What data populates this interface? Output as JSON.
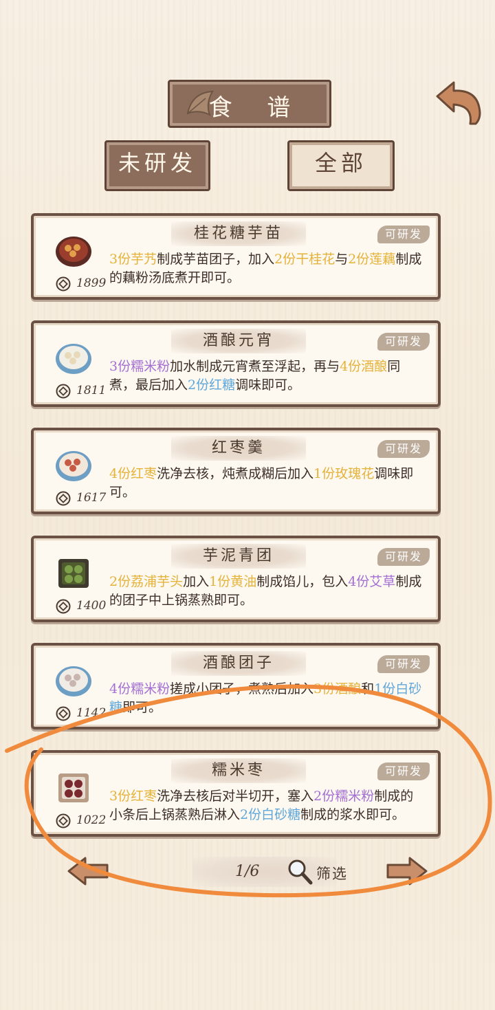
{
  "header": {
    "title": "食 谱"
  },
  "tabs": [
    {
      "label": "未研发",
      "active": true
    },
    {
      "label": "全部",
      "active": false
    }
  ],
  "recipes": [
    {
      "name": "桂花糖芋苗",
      "badge": "可研发",
      "price": "1899",
      "desc": [
        {
          "t": "3份芋艿",
          "c": "yellow"
        },
        {
          "t": "制成芋苗团子，加入"
        },
        {
          "t": "2份干桂花",
          "c": "yellow"
        },
        {
          "t": "与"
        },
        {
          "t": "2份莲藕",
          "c": "yellow"
        },
        {
          "t": "制成的藕粉汤底煮开即可。"
        }
      ]
    },
    {
      "name": "酒酿元宵",
      "badge": "可研发",
      "price": "1811",
      "desc": [
        {
          "t": "3份糯米粉",
          "c": "purple"
        },
        {
          "t": "加水制成元宵煮至浮起，再与"
        },
        {
          "t": "4份酒酿",
          "c": "yellow"
        },
        {
          "t": "同煮，最后加入"
        },
        {
          "t": "2份红糖",
          "c": "blue"
        },
        {
          "t": "调味即可。"
        }
      ]
    },
    {
      "name": "红枣羹",
      "badge": "可研发",
      "price": "1617",
      "desc": [
        {
          "t": "4份红枣",
          "c": "yellow"
        },
        {
          "t": "洗净去核，炖煮成糊后加入"
        },
        {
          "t": "1份玫瑰花",
          "c": "yellow"
        },
        {
          "t": "调味即可。"
        }
      ]
    },
    {
      "name": "芋泥青团",
      "badge": "可研发",
      "price": "1400",
      "desc": [
        {
          "t": "2份荔浦芋头",
          "c": "yellow"
        },
        {
          "t": "加入"
        },
        {
          "t": "1份黄油",
          "c": "yellow"
        },
        {
          "t": "制成馅儿，包入"
        },
        {
          "t": "4份艾草",
          "c": "purple"
        },
        {
          "t": "制成的团子中上锅蒸熟即可。"
        }
      ]
    },
    {
      "name": "酒酿团子",
      "badge": "可研发",
      "price": "1142",
      "desc": [
        {
          "t": "4份糯米粉",
          "c": "purple"
        },
        {
          "t": "搓成小团子，煮熟后加入"
        },
        {
          "t": "3份酒酿",
          "c": "yellow"
        },
        {
          "t": "和"
        },
        {
          "t": "1份白砂糖",
          "c": "blue"
        },
        {
          "t": "即可。"
        }
      ]
    },
    {
      "name": "糯米枣",
      "badge": "可研发",
      "price": "1022",
      "desc": [
        {
          "t": "3份红枣",
          "c": "yellow"
        },
        {
          "t": "洗净去核后对半切开，塞入"
        },
        {
          "t": "2份糯米粉",
          "c": "purple"
        },
        {
          "t": "制成的小条后上锅蒸熟后淋入"
        },
        {
          "t": "2份白砂糖",
          "c": "blue"
        },
        {
          "t": "制成的浆水即可。"
        }
      ]
    }
  ],
  "pagination": {
    "page": "1/6",
    "filter_label": "筛选"
  },
  "colors": {
    "frame": "#6b5143",
    "highlight_yellow": "#e5b23a",
    "highlight_purple": "#a46fd3",
    "highlight_blue": "#5fa7d9",
    "annotation": "#f08a3c"
  }
}
